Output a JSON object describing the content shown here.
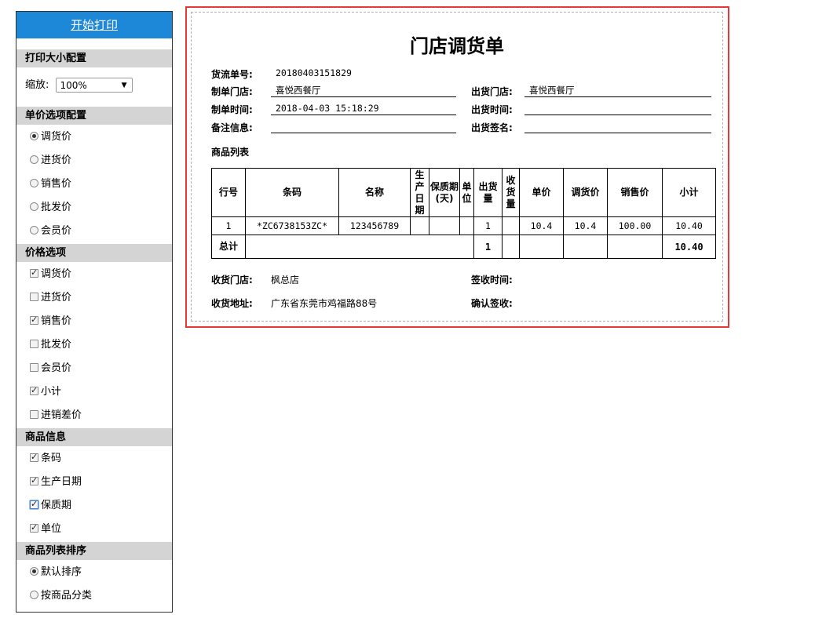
{
  "sidebar": {
    "print_button": "开始打印",
    "sections": {
      "print_size": "打印大小配置",
      "price_option": "单价选项配置",
      "price_columns": "价格选项",
      "goods_info": "商品信息",
      "sort": "商品列表排序"
    },
    "zoom_label": "缩放:",
    "zoom_value": "100%",
    "price_option_items": [
      "调货价",
      "进货价",
      "销售价",
      "批发价",
      "会员价"
    ],
    "price_column_items": [
      "调货价",
      "进货价",
      "销售价",
      "批发价",
      "会员价",
      "小计",
      "进销差价"
    ],
    "goods_info_items": [
      "条码",
      "生产日期",
      "保质期",
      "单位"
    ],
    "sort_items": [
      "默认排序",
      "按商品分类"
    ]
  },
  "doc": {
    "title": "门店调货单",
    "flow_no_label": "货流单号:",
    "flow_no": "20180403151829",
    "make_store_label": "制单门店:",
    "make_store": "喜悦西餐厅",
    "out_store_label": "出货门店:",
    "out_store": "喜悦西餐厅",
    "make_time_label": "制单时间:",
    "make_time": "2018-04-03 15:18:29",
    "out_time_label": "出货时间:",
    "out_time": "",
    "note_label": "备注信息:",
    "note": "",
    "out_sign_label": "出货签名:",
    "out_sign": "",
    "list_title": "商品列表",
    "table_headers": [
      "行号",
      "条码",
      "名称",
      "生产日期",
      "保质期(天)",
      "单位",
      "出货量",
      "收货量",
      "单价",
      "调货价",
      "销售价",
      "小计"
    ],
    "rows": [
      {
        "no": "1",
        "barcode": "*ZC6738153ZC*",
        "name": "123456789",
        "prod_date": "",
        "shelf": "",
        "unit": "",
        "out_qty": "1",
        "recv_qty": "",
        "unit_price": "10.4",
        "transfer_price": "10.4",
        "sale_price": "100.00",
        "subtotal": "10.40"
      }
    ],
    "total_label": "总计",
    "total_qty": "1",
    "total_amount": "10.40",
    "recv_store_label": "收货门店:",
    "recv_store": "枫总店",
    "sign_time_label": "签收时间:",
    "recv_addr_label": "收货地址:",
    "recv_addr": "广东省东莞市鸡福路88号",
    "confirm_label": "确认签收:"
  },
  "colors": {
    "accent": "#1e88d8",
    "frame": "#e53935",
    "section_bg": "#d4d4d4"
  }
}
